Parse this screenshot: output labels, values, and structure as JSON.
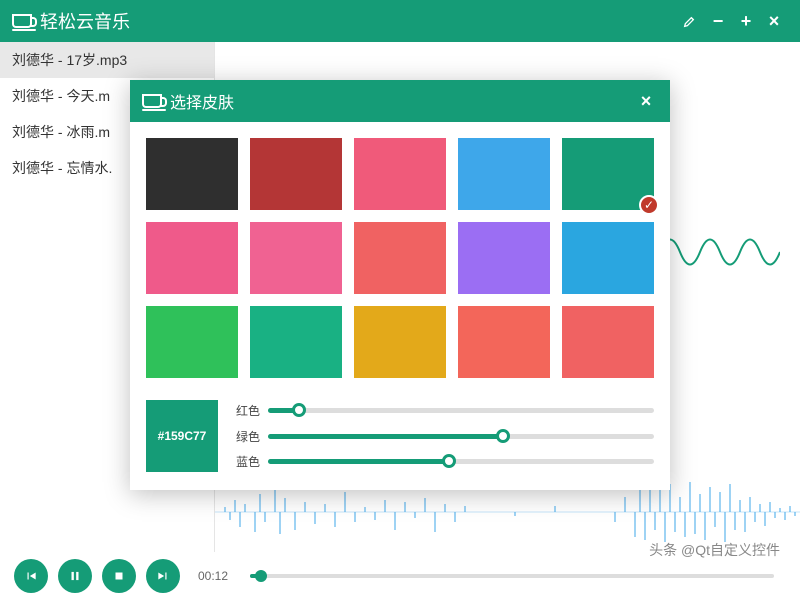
{
  "app": {
    "title": "轻松云音乐"
  },
  "window_buttons": {
    "picker": "✎",
    "min": "−",
    "add": "+",
    "close": "×"
  },
  "playlist": [
    {
      "label": "刘德华 - 17岁.mp3",
      "active": true
    },
    {
      "label": "刘德华 - 今天.m",
      "active": false
    },
    {
      "label": "刘德华 - 冰雨.m",
      "active": false
    },
    {
      "label": "刘德华 - 忘情水.",
      "active": false
    }
  ],
  "playback": {
    "time": "00:12",
    "progress_percent": 2
  },
  "dialog": {
    "title": "选择皮肤",
    "close": "×",
    "swatches": [
      {
        "color": "#2f2f2f",
        "selected": false
      },
      {
        "color": "#b43636",
        "selected": false
      },
      {
        "color": "#f05a7a",
        "selected": false
      },
      {
        "color": "#3ea7ea",
        "selected": false
      },
      {
        "color": "#159C77",
        "selected": true
      },
      {
        "color": "#ef5a8a",
        "selected": false
      },
      {
        "color": "#f06292",
        "selected": false
      },
      {
        "color": "#f06262",
        "selected": false
      },
      {
        "color": "#9b6ef3",
        "selected": false
      },
      {
        "color": "#2aa6e0",
        "selected": false
      },
      {
        "color": "#2fc15a",
        "selected": false
      },
      {
        "color": "#19b183",
        "selected": false
      },
      {
        "color": "#e3a91a",
        "selected": false
      },
      {
        "color": "#f3665a",
        "selected": false
      },
      {
        "color": "#f06262",
        "selected": false
      }
    ],
    "preview_hex": "#159C77",
    "sliders": {
      "red": {
        "label": "红色",
        "percent": 8
      },
      "green": {
        "label": "绿色",
        "percent": 61
      },
      "blue": {
        "label": "蓝色",
        "percent": 47
      }
    }
  },
  "watermark": "头条 @Qt自定义控件",
  "accent": "#159C77"
}
